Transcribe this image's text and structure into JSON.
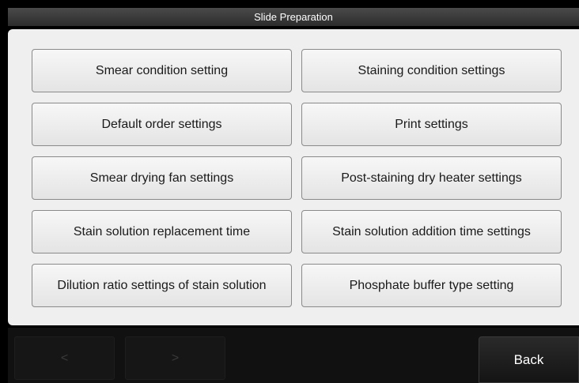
{
  "window": {
    "title": "Slide Preparation"
  },
  "menu": {
    "buttons": [
      {
        "label": "Smear condition setting"
      },
      {
        "label": "Staining condition settings"
      },
      {
        "label": "Default order settings"
      },
      {
        "label": "Print settings"
      },
      {
        "label": "Smear drying fan settings"
      },
      {
        "label": "Post-staining dry heater settings"
      },
      {
        "label": "Stain solution replacement time"
      },
      {
        "label": "Stain solution addition time settings"
      },
      {
        "label": "Dilution ratio settings of stain solution"
      },
      {
        "label": "Phosphate buffer type setting"
      }
    ]
  },
  "footer": {
    "prev_label": "<",
    "next_label": ">",
    "back_label": "Back"
  },
  "colors": {
    "panel_background": "#efefef",
    "title_bar": "#3a3a3a",
    "frame_background": "#000000"
  }
}
